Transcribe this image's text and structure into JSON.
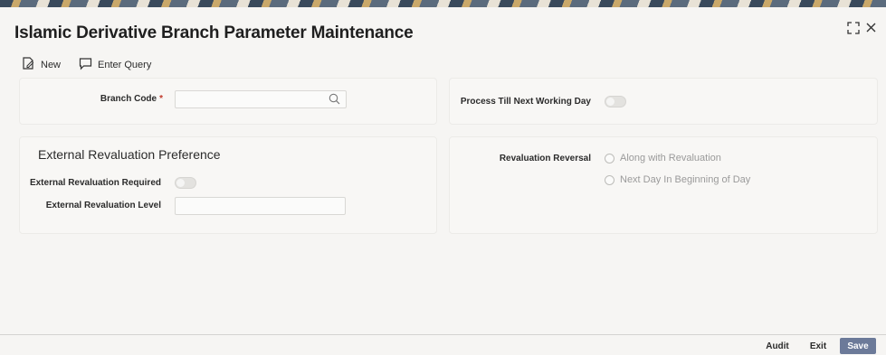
{
  "window": {
    "title": "Islamic Derivative Branch Parameter Maintenance",
    "expand_icon": "expand-icon",
    "close_icon": "close-icon"
  },
  "toolbar": {
    "new_label": "New",
    "enter_query_label": "Enter Query"
  },
  "branch": {
    "branch_code_label": "Branch Code",
    "required_marker": "*",
    "branch_code_value": "",
    "process_till_label": "Process Till Next Working Day",
    "process_till_on": false
  },
  "external_revaluation": {
    "heading": "External Revaluation Preference",
    "required_label": "External Revaluation Required",
    "required_on": false,
    "level_label": "External Revaluation Level",
    "level_value": ""
  },
  "revaluation_reversal": {
    "label": "Revaluation Reversal",
    "options": [
      "Along with Revaluation",
      "Next Day In Beginning of Day"
    ]
  },
  "footer": {
    "audit_label": "Audit",
    "exit_label": "Exit",
    "save_label": "Save"
  },
  "colors": {
    "save_button_bg": "#6c7a99",
    "required_marker": "#c0392b"
  }
}
